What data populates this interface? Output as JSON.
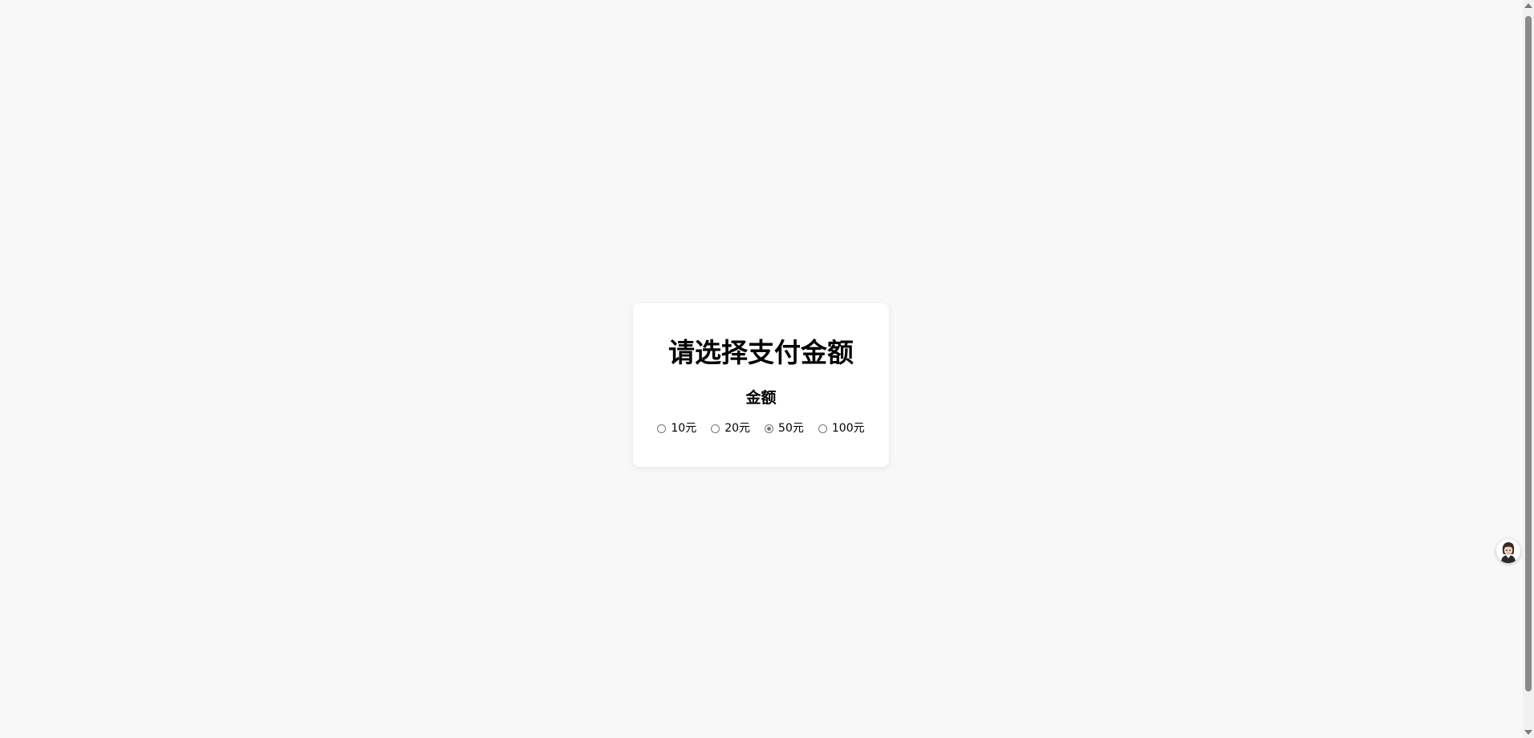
{
  "card": {
    "title": "请选择支付金额",
    "subtitle": "金额"
  },
  "amount_options": [
    {
      "label": "10元",
      "checked": false
    },
    {
      "label": "20元",
      "checked": false
    },
    {
      "label": "50元",
      "checked": true
    },
    {
      "label": "100元",
      "checked": false
    }
  ],
  "floating_assistant": {
    "icon": "avatar-icon"
  },
  "scrollbar": {
    "up_icon": "scroll-up-icon",
    "down_icon": "scroll-down-icon"
  }
}
